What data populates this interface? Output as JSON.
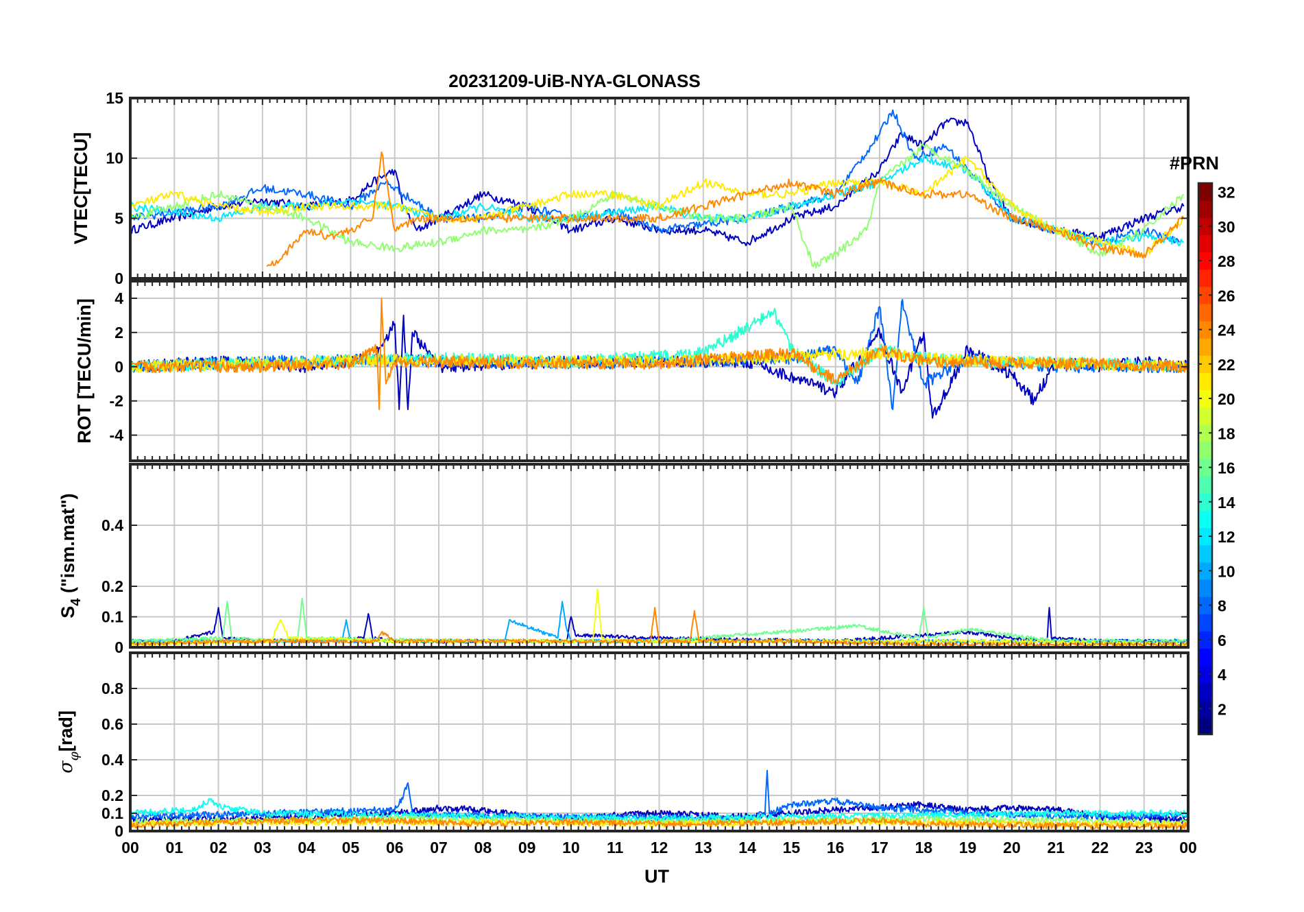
{
  "title": "20231209-UiB-NYA-GLONASS",
  "chart_data": [
    {
      "id": "vtec",
      "type": "line",
      "ylabel": "VTEC[TECU]",
      "ylim": [
        0,
        15
      ],
      "yticks": [
        0,
        5,
        10,
        15
      ],
      "xlim": [
        0,
        24
      ],
      "grid": true,
      "series": [
        {
          "color_index": 3,
          "x": [
            0,
            1,
            2,
            3,
            4,
            5,
            5.5,
            6,
            6.2,
            6.5,
            7,
            8,
            9,
            10,
            11,
            12,
            13,
            14,
            15,
            16,
            17,
            17.5,
            18,
            18.5,
            19,
            19.5,
            20,
            21,
            22,
            23,
            23.9
          ],
          "y": [
            4,
            5,
            6,
            6.5,
            6,
            6.5,
            8,
            9,
            6,
            4,
            5,
            7,
            6,
            4,
            5,
            4,
            4,
            3,
            5,
            6,
            9,
            12,
            11,
            13,
            13,
            8,
            5,
            4,
            3.5,
            5,
            6
          ]
        },
        {
          "color_index": 8,
          "x": [
            0,
            1,
            2,
            3,
            4,
            5,
            5.8,
            6.2,
            7,
            8,
            9,
            10,
            11,
            12,
            13,
            14,
            15,
            16,
            17,
            17.3,
            17.8,
            18.5,
            19,
            20,
            21,
            22,
            23,
            23.8
          ],
          "y": [
            5,
            5.5,
            6,
            7.5,
            7,
            6,
            8,
            7,
            5,
            5,
            6,
            5,
            5.5,
            4,
            4.5,
            5,
            6,
            7,
            12,
            14,
            10,
            11,
            9,
            5,
            4,
            3,
            4,
            3
          ]
        },
        {
          "color_index": 12,
          "x": [
            0,
            1,
            2,
            3,
            4,
            5,
            6,
            7,
            8,
            9,
            10,
            11,
            12,
            13,
            14,
            15,
            16,
            17,
            18,
            19,
            20,
            21,
            22,
            23,
            23.9
          ],
          "y": [
            6,
            5.5,
            5,
            6,
            6,
            6.5,
            6,
            5,
            6,
            5,
            5,
            5.5,
            6,
            5,
            5,
            6,
            7,
            8,
            10,
            9,
            5,
            4,
            3,
            3.5,
            3
          ]
        },
        {
          "color_index": 17,
          "x": [
            0,
            1,
            2,
            3,
            4,
            5,
            6,
            7,
            8,
            9,
            10,
            11,
            12,
            13,
            14,
            15,
            15.5,
            16,
            16.7,
            17,
            18,
            19,
            20,
            21,
            22,
            23,
            23.9
          ],
          "y": [
            5,
            6,
            7,
            6,
            5,
            3,
            2.5,
            3,
            4,
            4,
            5,
            7,
            6,
            5,
            5,
            6,
            1,
            2,
            4,
            8,
            11,
            9,
            6,
            4,
            2,
            4,
            7
          ]
        },
        {
          "color_index": 21,
          "x": [
            0,
            1,
            2,
            3,
            4,
            5,
            6,
            7,
            8,
            9,
            10,
            11,
            12,
            13,
            14,
            15,
            16,
            17,
            18,
            19,
            20,
            21,
            22,
            23,
            23.9
          ],
          "y": [
            6,
            7,
            6,
            5.5,
            6,
            6,
            6,
            5,
            5,
            6,
            7,
            7,
            6,
            8,
            7,
            7,
            8,
            8,
            7,
            10,
            6,
            4,
            3,
            2,
            5
          ]
        },
        {
          "color_index": 24,
          "x": [
            3.1,
            3.5,
            4,
            4.5,
            5,
            5.5,
            5.7,
            6,
            6.5,
            7,
            8,
            9,
            10,
            11,
            12,
            13,
            14,
            15,
            16,
            17,
            18,
            19,
            20,
            21,
            22,
            23,
            23.9
          ],
          "y": [
            1,
            2,
            4,
            3.5,
            4,
            5,
            10.5,
            4,
            5,
            5,
            5,
            5,
            5,
            5,
            5,
            6,
            7,
            8,
            7,
            8,
            7,
            7,
            5,
            4,
            2.5,
            2,
            5
          ]
        }
      ]
    },
    {
      "id": "rot",
      "type": "line",
      "ylabel": "ROT [TECU/min]",
      "ylim": [
        -5.5,
        5
      ],
      "yticks": [
        -4,
        -2,
        0,
        2,
        4
      ],
      "xlim": [
        0,
        24
      ],
      "grid": true,
      "series": [
        {
          "color_index": 3,
          "x": [
            0,
            2,
            4,
            5.5,
            6,
            6.1,
            6.2,
            6.3,
            6.4,
            7,
            10,
            14,
            16,
            17,
            17.5,
            18,
            18.2,
            19,
            20,
            20.5,
            21,
            22,
            23,
            24
          ],
          "y": [
            0,
            0.3,
            0,
            0.5,
            2.5,
            -2.5,
            3,
            -2.5,
            2,
            0,
            0.3,
            0.3,
            -1.5,
            2,
            -1.5,
            2,
            -3,
            1,
            -0.5,
            -2,
            0.3,
            0,
            0.3,
            0
          ]
        },
        {
          "color_index": 8,
          "x": [
            0,
            3,
            5,
            8,
            11,
            14,
            15,
            16,
            16.5,
            17,
            17.3,
            17.5,
            18,
            19,
            21,
            24
          ],
          "y": [
            0,
            0.3,
            0.4,
            0.3,
            0.2,
            0.4,
            0.5,
            1,
            -1,
            3.5,
            -2.5,
            3.8,
            -1,
            0.5,
            0,
            0
          ]
        },
        {
          "color_index": 14,
          "x": [
            0,
            4,
            7,
            10,
            13,
            14.6,
            15,
            16,
            17,
            18,
            19,
            22,
            24
          ],
          "y": [
            0,
            0.3,
            0.5,
            0.3,
            0.8,
            3.2,
            1,
            -1,
            1,
            0.5,
            0.3,
            0.2,
            0
          ]
        },
        {
          "color_index": 21,
          "x": [
            0,
            3,
            6,
            9,
            12,
            15,
            17,
            18,
            21,
            24
          ],
          "y": [
            0,
            0.2,
            0.4,
            0.3,
            0.3,
            0.6,
            0.8,
            0.5,
            0.2,
            0
          ]
        },
        {
          "color_index": 24,
          "x": [
            0,
            3,
            5,
            5.6,
            5.65,
            5.7,
            5.8,
            6,
            9,
            12,
            15,
            16,
            17,
            18,
            21,
            24
          ],
          "y": [
            0,
            0,
            0.2,
            1,
            -2.5,
            4,
            -1,
            0.3,
            0.2,
            0.2,
            0.8,
            -0.8,
            1,
            0.3,
            0.2,
            0
          ]
        }
      ]
    },
    {
      "id": "s4",
      "type": "line",
      "ylabel": "S₄ (\"ism.mat\")",
      "ylim": [
        0,
        0.6
      ],
      "yticks": [
        0,
        0.1,
        0.2,
        0.4
      ],
      "xlim": [
        0,
        24
      ],
      "grid": true,
      "series": [
        {
          "color_index": 3,
          "x": [
            0,
            1,
            1.9,
            2,
            2.1,
            3,
            5.3,
            5.4,
            5.5,
            6,
            9.9,
            10,
            10.1,
            12,
            16,
            18,
            19,
            20,
            20.8,
            20.85,
            20.9,
            22,
            24
          ],
          "y": [
            0.02,
            0.02,
            0.05,
            0.13,
            0.03,
            0.02,
            0.03,
            0.11,
            0.03,
            0.02,
            0.02,
            0.1,
            0.04,
            0.03,
            0.02,
            0.04,
            0.05,
            0.03,
            0.02,
            0.13,
            0.03,
            0.02,
            0.02
          ]
        },
        {
          "color_index": 10,
          "x": [
            0,
            4.8,
            4.9,
            5,
            8.5,
            8.6,
            9.7,
            9.8,
            9.9,
            10,
            12,
            15,
            18,
            21,
            24
          ],
          "y": [
            0.02,
            0.02,
            0.09,
            0.02,
            0.02,
            0.09,
            0.03,
            0.15,
            0.06,
            0.02,
            0.02,
            0.02,
            0.02,
            0.02,
            0.02
          ]
        },
        {
          "color_index": 16,
          "x": [
            0,
            2.1,
            2.2,
            2.3,
            3.5,
            3.8,
            3.9,
            4,
            8,
            12,
            16.5,
            17.9,
            18,
            18.1,
            19,
            21,
            24
          ],
          "y": [
            0.02,
            0.03,
            0.15,
            0.03,
            0.02,
            0.03,
            0.16,
            0.03,
            0.02,
            0.02,
            0.07,
            0.03,
            0.13,
            0.03,
            0.06,
            0.02,
            0.02
          ]
        },
        {
          "color_index": 20,
          "x": [
            0,
            3.2,
            3.4,
            3.6,
            6,
            10.5,
            10.6,
            10.7,
            11,
            14,
            17,
            20,
            24
          ],
          "y": [
            0.01,
            0.02,
            0.09,
            0.03,
            0.02,
            0.02,
            0.19,
            0.03,
            0.02,
            0.02,
            0.02,
            0.02,
            0.01
          ]
        },
        {
          "color_index": 24,
          "x": [
            0,
            2,
            5.6,
            5.7,
            6,
            11.8,
            11.9,
            12,
            12.7,
            12.8,
            12.9,
            15,
            18,
            24
          ],
          "y": [
            0.01,
            0.02,
            0.02,
            0.05,
            0.02,
            0.02,
            0.13,
            0.02,
            0.02,
            0.12,
            0.02,
            0.02,
            0.01,
            0.01
          ]
        }
      ]
    },
    {
      "id": "sigma",
      "type": "line",
      "ylabel": "σ_φ[rad]",
      "ylim": [
        0,
        1
      ],
      "yticks": [
        0,
        0.1,
        0.2,
        0.4,
        0.6,
        0.8
      ],
      "xlim": [
        0,
        24
      ],
      "grid": true,
      "series": [
        {
          "color_index": 3,
          "x": [
            0,
            3,
            6,
            7,
            8,
            9,
            10,
            11,
            12,
            14,
            16,
            17,
            18,
            18.5,
            19,
            20,
            21,
            22,
            24
          ],
          "y": [
            0.06,
            0.07,
            0.1,
            0.13,
            0.12,
            0.08,
            0.07,
            0.09,
            0.1,
            0.08,
            0.12,
            0.13,
            0.15,
            0.13,
            0.12,
            0.13,
            0.12,
            0.08,
            0.06
          ]
        },
        {
          "color_index": 8,
          "x": [
            0,
            3,
            6,
            6.2,
            6.3,
            6.4,
            7,
            10,
            14,
            14.4,
            14.45,
            14.5,
            15,
            16,
            17,
            18,
            19,
            22,
            24
          ],
          "y": [
            0.08,
            0.1,
            0.12,
            0.2,
            0.27,
            0.1,
            0.09,
            0.08,
            0.07,
            0.1,
            0.34,
            0.1,
            0.15,
            0.17,
            0.13,
            0.12,
            0.1,
            0.08,
            0.09
          ]
        },
        {
          "color_index": 13,
          "x": [
            0,
            1.5,
            1.8,
            2,
            3,
            6,
            9,
            12,
            15,
            18,
            21,
            24
          ],
          "y": [
            0.1,
            0.12,
            0.18,
            0.14,
            0.1,
            0.09,
            0.08,
            0.07,
            0.08,
            0.09,
            0.1,
            0.1
          ]
        },
        {
          "color_index": 17,
          "x": [
            0,
            3,
            6,
            9,
            12,
            15,
            18,
            21,
            24
          ],
          "y": [
            0.05,
            0.06,
            0.07,
            0.06,
            0.05,
            0.06,
            0.07,
            0.06,
            0.05
          ]
        },
        {
          "color_index": 21,
          "x": [
            0,
            3,
            6,
            9,
            12,
            15,
            18,
            21,
            24
          ],
          "y": [
            0.04,
            0.05,
            0.05,
            0.05,
            0.04,
            0.05,
            0.05,
            0.04,
            0.04
          ]
        },
        {
          "color_index": 24,
          "x": [
            0,
            2,
            4,
            6,
            8,
            10,
            12,
            15,
            17,
            18,
            21,
            24
          ],
          "y": [
            0.03,
            0.05,
            0.06,
            0.06,
            0.04,
            0.05,
            0.04,
            0.05,
            0.06,
            0.04,
            0.03,
            0.03
          ]
        }
      ]
    }
  ],
  "x_axis": {
    "label": "UT",
    "tick_labels": [
      "00",
      "01",
      "02",
      "03",
      "04",
      "05",
      "06",
      "07",
      "08",
      "09",
      "10",
      "11",
      "12",
      "13",
      "14",
      "15",
      "16",
      "17",
      "18",
      "19",
      "20",
      "21",
      "22",
      "23",
      "00"
    ]
  },
  "colorbar": {
    "title": "#PRN",
    "range": [
      1,
      32
    ],
    "tick_values": [
      2,
      4,
      6,
      8,
      10,
      12,
      14,
      16,
      18,
      20,
      22,
      24,
      26,
      28,
      30,
      32
    ],
    "tick_labels": [
      "2",
      "4",
      "6",
      "8",
      "10",
      "12",
      "14",
      "16",
      "18",
      "20",
      "22",
      "24",
      "26",
      "28",
      "30",
      "32"
    ],
    "colormap": "jet"
  }
}
